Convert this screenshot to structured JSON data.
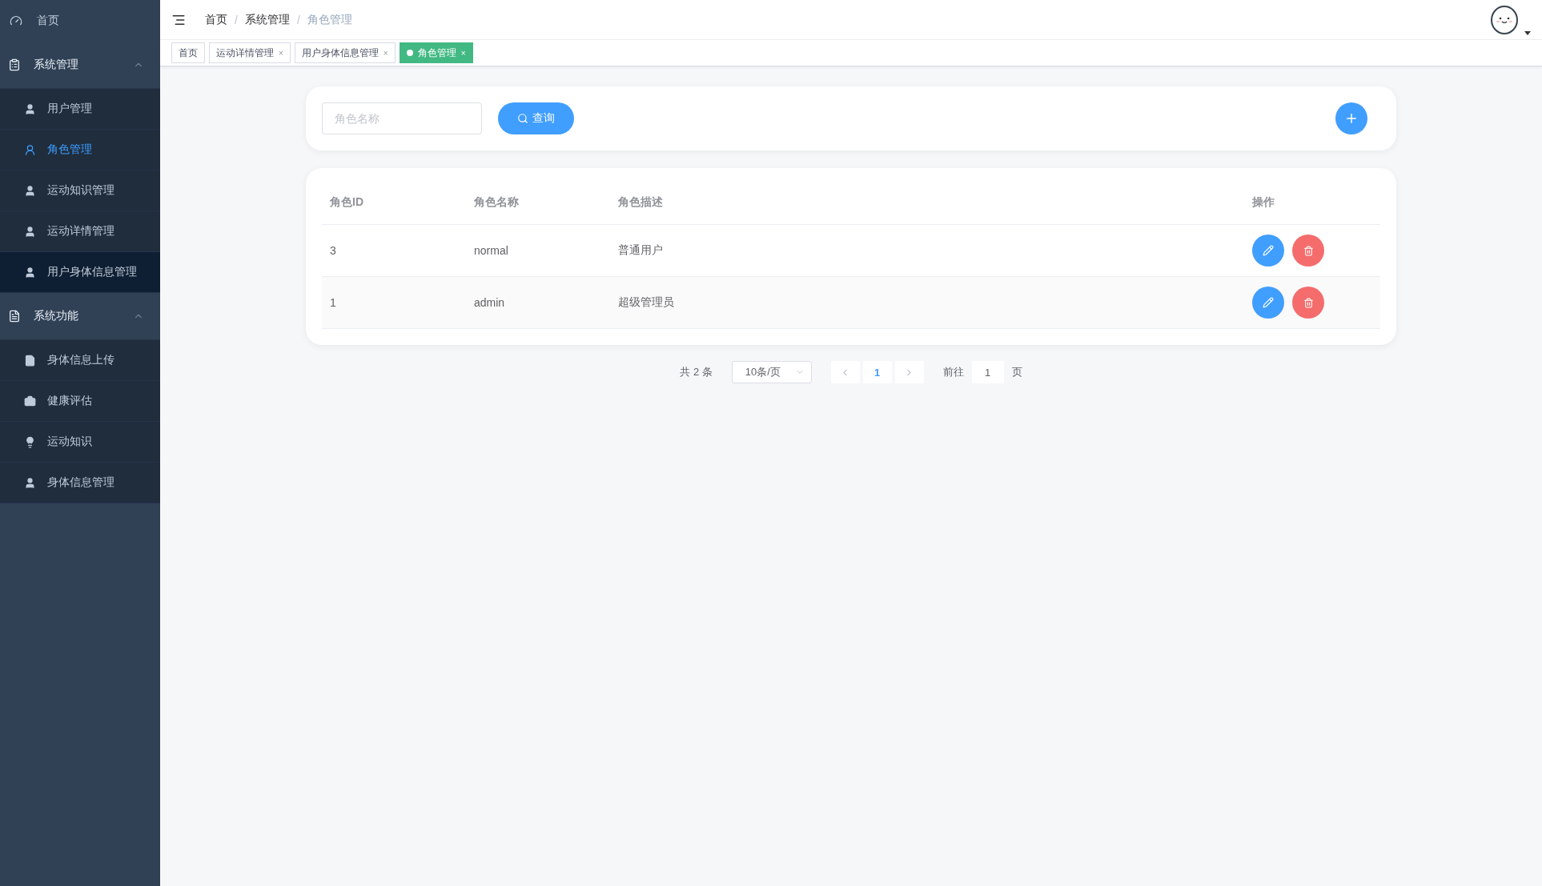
{
  "sidebar": {
    "items": [
      {
        "kind": "item",
        "label": "首页",
        "selected": false
      },
      {
        "kind": "group",
        "label": "系统管理",
        "expanded": true,
        "children": [
          {
            "label": "用户管理",
            "selected": false,
            "highlighted": false
          },
          {
            "label": "角色管理",
            "selected": true,
            "highlighted": false
          },
          {
            "label": "运动知识管理",
            "selected": false,
            "highlighted": false
          },
          {
            "label": "运动详情管理",
            "selected": false,
            "highlighted": false
          },
          {
            "label": "用户身体信息管理",
            "selected": false,
            "highlighted": true
          }
        ]
      },
      {
        "kind": "group",
        "label": "系统功能",
        "expanded": true,
        "children": [
          {
            "label": "身体信息上传",
            "selected": false,
            "highlighted": false
          },
          {
            "label": "健康评估",
            "selected": false,
            "highlighted": false
          },
          {
            "label": "运动知识",
            "selected": false,
            "highlighted": false
          },
          {
            "label": "身体信息管理",
            "selected": false,
            "highlighted": false
          }
        ]
      }
    ]
  },
  "breadcrumb": [
    {
      "label": "首页",
      "current": false
    },
    {
      "label": "系统管理",
      "current": false
    },
    {
      "label": "角色管理",
      "current": true
    }
  ],
  "breadcrumb_separator": "/",
  "tags": [
    {
      "label": "首页",
      "closable": false,
      "selected": false
    },
    {
      "label": "运动详情管理",
      "closable": true,
      "selected": false
    },
    {
      "label": "用户身体信息管理",
      "closable": true,
      "selected": false
    },
    {
      "label": "角色管理",
      "closable": true,
      "selected": true
    }
  ],
  "tag_close": "×",
  "search": {
    "placeholder": "角色名称",
    "button": "查询"
  },
  "table": {
    "columns": [
      "角色ID",
      "角色名称",
      "角色描述",
      "操作"
    ],
    "rows": [
      {
        "id": "3",
        "name": "normal",
        "description": "普通用户"
      },
      {
        "id": "1",
        "name": "admin",
        "description": "超级管理员"
      }
    ]
  },
  "pagination": {
    "total": "共 2 条",
    "page_size": "10条/页",
    "pages": [
      {
        "label": "1",
        "selected": true
      }
    ],
    "jump_label": "前往",
    "jump_value": "1",
    "jump_suffix": "页"
  }
}
